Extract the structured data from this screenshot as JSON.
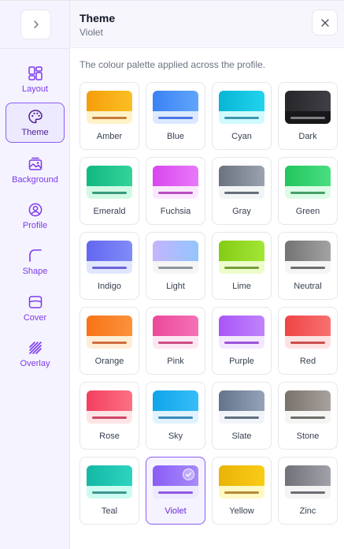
{
  "header": {
    "title": "Theme",
    "subtitle": "Violet",
    "description": "The colour palette applied across the profile."
  },
  "sidebar": {
    "items": [
      {
        "label": "Layout",
        "icon": "layout-icon"
      },
      {
        "label": "Theme",
        "icon": "palette-icon",
        "active": true
      },
      {
        "label": "Background",
        "icon": "image-icon"
      },
      {
        "label": "Profile",
        "icon": "user-icon"
      },
      {
        "label": "Shape",
        "icon": "corner-icon"
      },
      {
        "label": "Cover",
        "icon": "cover-icon"
      },
      {
        "label": "Overlay",
        "icon": "hatch-icon"
      }
    ]
  },
  "themes": [
    {
      "name": "Amber",
      "from": "#f59e0b",
      "to": "#fbbf24",
      "base": "#fef3c7",
      "bar": "#b45309"
    },
    {
      "name": "Blue",
      "from": "#3b82f6",
      "to": "#60a5fa",
      "base": "#dbeafe",
      "bar": "#1d4ed8"
    },
    {
      "name": "Cyan",
      "from": "#06b6d4",
      "to": "#22d3ee",
      "base": "#cffafe",
      "bar": "#0e7490"
    },
    {
      "name": "Dark",
      "from": "#27272a",
      "to": "#3f3f46",
      "base": "#18181b",
      "bar": "#a1a1aa"
    },
    {
      "name": "Emerald",
      "from": "#10b981",
      "to": "#34d399",
      "base": "#d1fae5",
      "bar": "#047857"
    },
    {
      "name": "Fuchsia",
      "from": "#d946ef",
      "to": "#e879f9",
      "base": "#fae8ff",
      "bar": "#a21caf"
    },
    {
      "name": "Gray",
      "from": "#6b7280",
      "to": "#9ca3af",
      "base": "#f3f4f6",
      "bar": "#374151"
    },
    {
      "name": "Green",
      "from": "#22c55e",
      "to": "#4ade80",
      "base": "#dcfce7",
      "bar": "#15803d"
    },
    {
      "name": "Indigo",
      "from": "#6366f1",
      "to": "#818cf8",
      "base": "#e0e7ff",
      "bar": "#4338ca"
    },
    {
      "name": "Light",
      "from": "#c4b5fd",
      "to": "#93c5fd",
      "base": "#f5f5f5",
      "bar": "#6b7280"
    },
    {
      "name": "Lime",
      "from": "#84cc16",
      "to": "#a3e635",
      "base": "#ecfccb",
      "bar": "#4d7c0f"
    },
    {
      "name": "Neutral",
      "from": "#737373",
      "to": "#a3a3a3",
      "base": "#f5f5f5",
      "bar": "#404040"
    },
    {
      "name": "Orange",
      "from": "#f97316",
      "to": "#fb923c",
      "base": "#ffedd5",
      "bar": "#c2410c"
    },
    {
      "name": "Pink",
      "from": "#ec4899",
      "to": "#f472b6",
      "base": "#fce7f3",
      "bar": "#be185d"
    },
    {
      "name": "Purple",
      "from": "#a855f7",
      "to": "#c084fc",
      "base": "#f3e8ff",
      "bar": "#7e22ce"
    },
    {
      "name": "Red",
      "from": "#ef4444",
      "to": "#f87171",
      "base": "#fee2e2",
      "bar": "#b91c1c"
    },
    {
      "name": "Rose",
      "from": "#f43f5e",
      "to": "#fb7185",
      "base": "#ffe4e6",
      "bar": "#be123c"
    },
    {
      "name": "Sky",
      "from": "#0ea5e9",
      "to": "#38bdf8",
      "base": "#e0f2fe",
      "bar": "#0369a1"
    },
    {
      "name": "Slate",
      "from": "#64748b",
      "to": "#94a3b8",
      "base": "#f1f5f9",
      "bar": "#334155"
    },
    {
      "name": "Stone",
      "from": "#78716c",
      "to": "#a8a29e",
      "base": "#f5f5f4",
      "bar": "#44403c"
    },
    {
      "name": "Teal",
      "from": "#14b8a6",
      "to": "#2dd4bf",
      "base": "#ccfbf1",
      "bar": "#0f766e"
    },
    {
      "name": "Violet",
      "from": "#8b5cf6",
      "to": "#a78bfa",
      "base": "#ede9fe",
      "bar": "#6d28d9",
      "selected": true
    },
    {
      "name": "Yellow",
      "from": "#eab308",
      "to": "#facc15",
      "base": "#fef9c3",
      "bar": "#a16207"
    },
    {
      "name": "Zinc",
      "from": "#71717a",
      "to": "#a1a1aa",
      "base": "#f4f4f5",
      "bar": "#3f3f46"
    }
  ]
}
